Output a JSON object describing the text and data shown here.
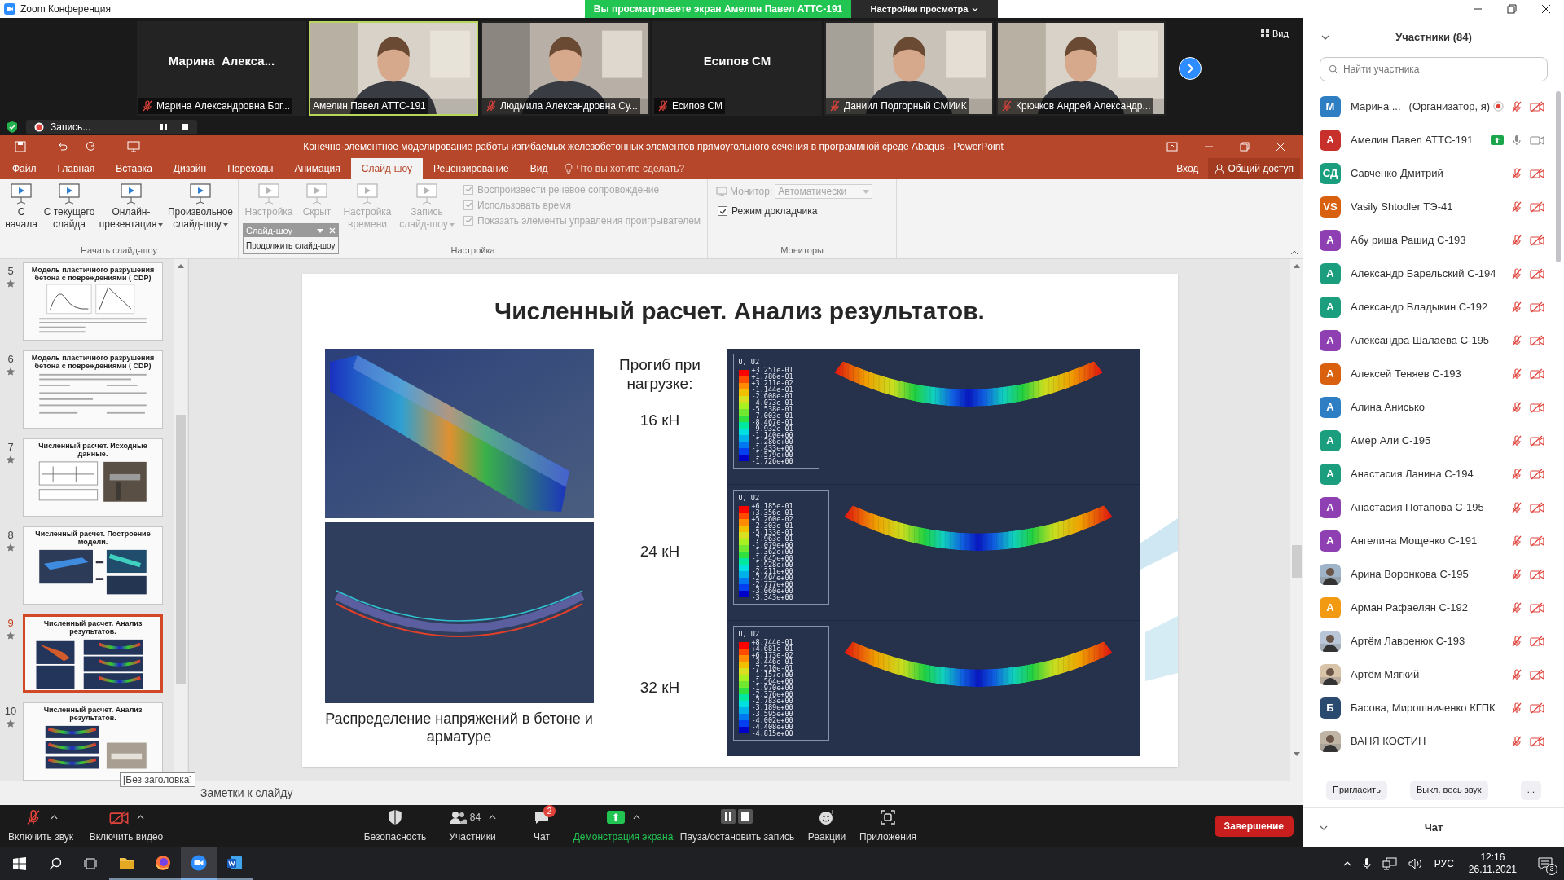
{
  "zoom_window": {
    "title": "Zoom Конференция",
    "banner": "Вы просматриваете экран Амелин Павел АТТС-191",
    "view_options": "Настройки просмотра"
  },
  "video_strip": {
    "view_button": "Вид",
    "tiles": [
      {
        "kind": "name",
        "title": "Марина  Алекса...",
        "label": "Марина Александровна Бог...",
        "muted": true,
        "speaking": false
      },
      {
        "kind": "video",
        "label": "Амелин Павел АТТС-191",
        "muted": false,
        "speaking": true
      },
      {
        "kind": "video",
        "label": "Людмила Александровна Су...",
        "muted": true,
        "speaking": false
      },
      {
        "kind": "name",
        "title": "Есипов СМ",
        "label": "Есипов СМ",
        "muted": true,
        "speaking": false
      },
      {
        "kind": "video",
        "label": "Даниил Подгорный СМИиК",
        "muted": true,
        "speaking": false
      },
      {
        "kind": "video",
        "label": "Крючков Андрей Александр...",
        "muted": true,
        "speaking": false
      }
    ]
  },
  "recording": {
    "label": "Запись..."
  },
  "powerpoint": {
    "title": "Конечно-элементное моделирование работы изгибаемых железобетонных элементов прямоугольного сечения в программной среде Abaqus - PowerPoint",
    "tabs": [
      {
        "label": "Файл",
        "selected": false
      },
      {
        "label": "Главная",
        "selected": false
      },
      {
        "label": "Вставка",
        "selected": false
      },
      {
        "label": "Дизайн",
        "selected": false
      },
      {
        "label": "Переходы",
        "selected": false
      },
      {
        "label": "Анимация",
        "selected": false
      },
      {
        "label": "Слайд-шоу",
        "selected": true
      },
      {
        "label": "Рецензирование",
        "selected": false
      },
      {
        "label": "Вид",
        "selected": false
      }
    ],
    "tell_me": "Что вы хотите сделать?",
    "sign_in": "Вход",
    "share": "Общий доступ",
    "ribbon": {
      "start_group": {
        "label": "Начать слайд-шоу",
        "buttons": [
          {
            "lines": [
              "С",
              "начала"
            ],
            "dropdown": false,
            "disabled": false
          },
          {
            "lines": [
              "С текущего",
              "слайда"
            ],
            "dropdown": false,
            "disabled": false
          },
          {
            "lines": [
              "Онлайн-",
              "презентация"
            ],
            "dropdown": true,
            "disabled": false
          },
          {
            "lines": [
              "Произвольное",
              "слайд-шоу"
            ],
            "dropdown": true,
            "disabled": false
          }
        ]
      },
      "setup_group": {
        "label": "Настройка",
        "buttons": [
          {
            "lines": [
              "Настройка"
            ],
            "dropdown": false,
            "disabled": true
          },
          {
            "lines": [
              "Скрыт"
            ],
            "dropdown": false,
            "disabled": true
          },
          {
            "lines": [
              "Настройка",
              "времени"
            ],
            "dropdown": false,
            "disabled": true
          },
          {
            "lines": [
              "Запись",
              "слайд-шоу"
            ],
            "dropdown": true,
            "disabled": true
          }
        ],
        "checkboxes": [
          {
            "label": "Воспроизвести речевое сопровождение",
            "checked": true,
            "disabled": true
          },
          {
            "label": "Использовать время",
            "checked": true,
            "disabled": true
          },
          {
            "label": "Показать элементы управления проигрывателем",
            "checked": true,
            "disabled": true
          }
        ]
      },
      "monitors_group": {
        "label": "Мониторы",
        "monitor_label": "Монитор:",
        "monitor_value": "Автоматически",
        "presenter_view": {
          "label": "Режим докладчика",
          "checked": true
        }
      }
    },
    "floating_toolbar": {
      "title": "Слайд-шоу",
      "button": "Продолжить слайд-шоу"
    },
    "thumbnails": [
      {
        "number": "5",
        "kind": "graphs",
        "title": "Модель пластичного разрушения бетона с повреждениями ( CDP)",
        "selected": false
      },
      {
        "number": "6",
        "kind": "formulas",
        "title": "Модель пластичного разрушения бетона с повреждениями ( CDP)",
        "selected": false
      },
      {
        "number": "7",
        "kind": "input",
        "title": "Численный расчет. Исходные данные.",
        "selected": false
      },
      {
        "number": "8",
        "kind": "model",
        "title": "Численный расчет. Построение модели.",
        "selected": false
      },
      {
        "number": "9",
        "kind": "results",
        "title": "Численный расчет. Анализ результатов.",
        "selected": true
      },
      {
        "number": "10",
        "kind": "results_photo",
        "title": "Численный расчет. Анализ результатов.",
        "selected": false
      }
    ],
    "tooltip": "[Без заголовка]",
    "slide": {
      "title": "Численный расчет. Анализ результатов.",
      "deflection_label": "Прогиб при нагрузке:",
      "caption": "Распределение напряжений в бетоне и арматуре",
      "results": [
        {
          "load": "16 кН",
          "legend_title": "U, U2",
          "values": [
            "+3.251e-01",
            "+1.786e-01",
            "+3.211e-02",
            "-1.144e-01",
            "-2.608e-01",
            "-4.073e-01",
            "-5.538e-01",
            "-7.003e-01",
            "-8.467e-01",
            "-9.932e-01",
            "-1.140e+00",
            "-1.286e+00",
            "-1.433e+00",
            "-1.579e+00",
            "-1.726e+00"
          ]
        },
        {
          "load": "24 кН",
          "legend_title": "U, U2",
          "values": [
            "+6.185e-01",
            "+3.356e-01",
            "+5.260e-02",
            "-2.303e-01",
            "-5.133e-01",
            "-7.963e-01",
            "-1.079e+00",
            "-1.362e+00",
            "-1.645e+00",
            "-1.928e+00",
            "-2.211e+00",
            "-2.494e+00",
            "-2.777e+00",
            "-3.060e+00",
            "-3.343e+00"
          ]
        },
        {
          "load": "32 кН",
          "legend_title": "U, U2",
          "values": [
            "+8.744e-01",
            "+4.681e-01",
            "+6.173e-02",
            "-3.446e-01",
            "-7.510e-01",
            "-1.157e+00",
            "-1.564e+00",
            "-1.970e+00",
            "-2.376e+00",
            "-2.783e+00",
            "-3.189e+00",
            "-3.595e+00",
            "-4.002e+00",
            "-4.408e+00",
            "-4.815e+00"
          ]
        }
      ]
    },
    "notes": "Заметки к слайду"
  },
  "meeting_toolbar": {
    "items": [
      {
        "kind": "audio",
        "label": "Включить звук",
        "caret": true
      },
      {
        "kind": "video",
        "label": "Включить видео",
        "caret": true
      },
      {
        "kind": "security",
        "label": "Безопасность",
        "caret": false
      },
      {
        "kind": "participants",
        "label": "Участники",
        "count": "84",
        "caret": true
      },
      {
        "kind": "chat",
        "label": "Чат",
        "badge": "2",
        "caret": false
      },
      {
        "kind": "share",
        "label": "Демонстрация экрана",
        "caret": true
      },
      {
        "kind": "record",
        "label": "Пауза/остановить запись",
        "caret": false
      },
      {
        "kind": "reactions",
        "label": "Реакции",
        "caret": false
      },
      {
        "kind": "apps",
        "label": "Приложения",
        "caret": false
      }
    ],
    "end_button": "Завершение"
  },
  "participants_panel": {
    "title": "Участники (84)",
    "search_placeholder": "Найти участника",
    "participants": [
      {
        "name": "Марина ...",
        "note": "(Организатор, я)",
        "avatar": {
          "kind": "initials",
          "initials": "М",
          "color": "#2e7ec4"
        },
        "recording": true,
        "sharing": false,
        "muted": true,
        "video_off": true
      },
      {
        "name": "Амелин Павел АТТС-191",
        "avatar": {
          "kind": "initials",
          "initials": "А",
          "color": "#c7302b"
        },
        "recording": false,
        "sharing": true,
        "muted": false,
        "video_off": false
      },
      {
        "name": "Савченко Дмитрий",
        "avatar": {
          "kind": "initials",
          "initials": "СД",
          "color": "#1a9e7e"
        },
        "recording": false,
        "sharing": false,
        "muted": true,
        "video_off": true
      },
      {
        "name": "Vasily Shtodler ТЭ-41",
        "avatar": {
          "kind": "initials",
          "initials": "VS",
          "color": "#d9600f"
        },
        "recording": false,
        "sharing": false,
        "muted": true,
        "video_off": true
      },
      {
        "name": "Абу риша Рашид С-193",
        "avatar": {
          "kind": "initials",
          "initials": "А",
          "color": "#8e3fb2"
        },
        "recording": false,
        "sharing": false,
        "muted": true,
        "video_off": true
      },
      {
        "name": "Александр Барельский С-194",
        "avatar": {
          "kind": "initials",
          "initials": "А",
          "color": "#1a9e7e"
        },
        "recording": false,
        "sharing": false,
        "muted": true,
        "video_off": true
      },
      {
        "name": "Александр Владыкин С-192",
        "avatar": {
          "kind": "initials",
          "initials": "А",
          "color": "#1a9e7e"
        },
        "recording": false,
        "sharing": false,
        "muted": true,
        "video_off": true
      },
      {
        "name": "Александра Шалаева С-195",
        "avatar": {
          "kind": "initials",
          "initials": "А",
          "color": "#8e3fb2"
        },
        "recording": false,
        "sharing": false,
        "muted": true,
        "video_off": true
      },
      {
        "name": "Алексей Теняев С-193",
        "avatar": {
          "kind": "initials",
          "initials": "А",
          "color": "#d9600f"
        },
        "recording": false,
        "sharing": false,
        "muted": true,
        "video_off": true
      },
      {
        "name": "Алина Анисько",
        "avatar": {
          "kind": "initials",
          "initials": "А",
          "color": "#2e7ec4"
        },
        "recording": false,
        "sharing": false,
        "muted": true,
        "video_off": true
      },
      {
        "name": "Амер Али С-195",
        "avatar": {
          "kind": "initials",
          "initials": "А",
          "color": "#1a9e7e"
        },
        "recording": false,
        "sharing": false,
        "muted": true,
        "video_off": true
      },
      {
        "name": "Анастасия Ланина С-194",
        "avatar": {
          "kind": "initials",
          "initials": "А",
          "color": "#1a9e7e"
        },
        "recording": false,
        "sharing": false,
        "muted": true,
        "video_off": true
      },
      {
        "name": "Анастасия Потапова С-195",
        "avatar": {
          "kind": "initials",
          "initials": "А",
          "color": "#8e3fb2"
        },
        "recording": false,
        "sharing": false,
        "muted": true,
        "video_off": true
      },
      {
        "name": "Ангелина Мощенко С-191",
        "avatar": {
          "kind": "initials",
          "initials": "А",
          "color": "#8e3fb2"
        },
        "recording": false,
        "sharing": false,
        "muted": true,
        "video_off": true
      },
      {
        "name": "Арина Воронкова С-195",
        "recording": false,
        "sharing": false,
        "muted": true,
        "video_off": true
      },
      {
        "name": "Арман Рафаелян С-192",
        "avatar": {
          "kind": "initials",
          "initials": "А",
          "color": "#f29a12"
        },
        "recording": false,
        "sharing": false,
        "muted": true,
        "video_off": true
      },
      {
        "name": "Артём Лавренюк С-193",
        "recording": false,
        "sharing": false,
        "muted": true,
        "video_off": true
      },
      {
        "name": "Артём Мягкий",
        "recording": false,
        "sharing": false,
        "muted": true,
        "video_off": true
      },
      {
        "name": "Басова, Мирошниченко КГПК",
        "avatar": {
          "kind": "initials",
          "initials": "Б",
          "color": "#2b4a6f"
        },
        "recording": false,
        "sharing": false,
        "muted": true,
        "video_off": true
      },
      {
        "name": "ВАНЯ КОСТИН",
        "recording": false,
        "sharing": false,
        "muted": true,
        "video_off": true
      }
    ],
    "buttons": [
      "Пригласить",
      "Выкл. весь звук",
      "..."
    ],
    "chat_title": "Чат"
  },
  "taskbar": {
    "apps": [
      {
        "kind": "explorer",
        "active": false
      },
      {
        "kind": "firefox",
        "active": false
      },
      {
        "kind": "zoom",
        "active": true
      },
      {
        "kind": "word",
        "active": false
      }
    ],
    "language": "РУС",
    "time": "12:16",
    "date": "26.11.2021",
    "notifications": "3"
  }
}
